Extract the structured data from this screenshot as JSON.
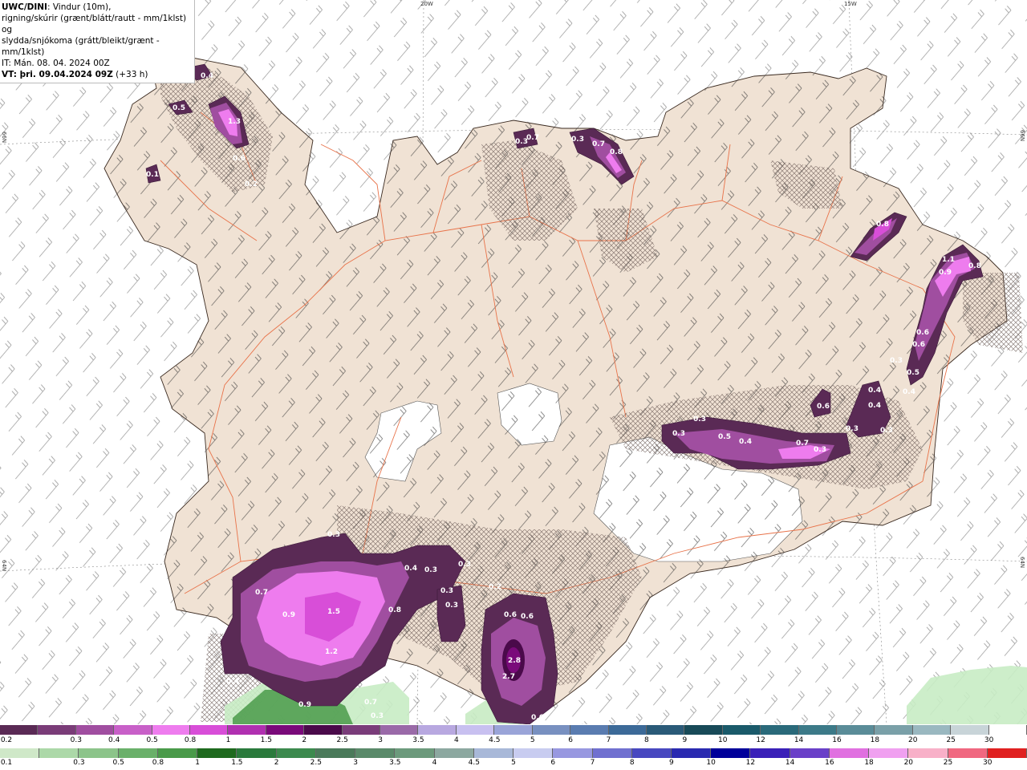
{
  "header": {
    "model": "UWC/DINI",
    "line1_rest": ": Vindur (10m),",
    "line2": "rigning/skúrir (grænt/blátt/rautt - mm/1klst) og",
    "line3": "slydda/snjókoma (grátt/bleikt/grænt - mm/1klst)",
    "line4": "IT: Mán. 08. 04. 2024 00Z",
    "line5_bold": "VT: þri. 09.04.2024 09Z",
    "line5_rest": " (+33 h)"
  },
  "graticule": {
    "lon_top": [
      "20W",
      "15W"
    ],
    "lat_left": [
      "66N",
      "64N"
    ],
    "lat_right": [
      "66N",
      "64N"
    ]
  },
  "values": [
    "0.4",
    "0.5",
    "1.3",
    "0.6",
    "0.1",
    "0.2",
    "0.3",
    "0.7",
    "0.3",
    "0.7",
    "0.8",
    "0.8",
    "1.1",
    "0.9",
    "0.8",
    "0.6",
    "0.6",
    "0.3",
    "0.5",
    "0.4",
    "0.6",
    "0.4",
    "0.4",
    "0.3",
    "0.3",
    "0.3",
    "0.5",
    "0.4",
    "0.7",
    "0.3",
    "0.3",
    "0.4",
    "0.3",
    "0.3",
    "0.2",
    "0.3",
    "0.3",
    "0.3",
    "0.7",
    "0.9",
    "1.5",
    "0.8",
    "1.2",
    "0.4",
    "0.9",
    "0.7",
    "0.3",
    "0.6",
    "0.6",
    "2.8",
    "2.7",
    "0.6"
  ],
  "legend_snow": {
    "labels": [
      "0.2",
      "0.3",
      "0.4",
      "0.5",
      "0.8",
      "1",
      "1.5",
      "2",
      "2.5",
      "3",
      "3.5",
      "4",
      "4.5",
      "5",
      "6",
      "7",
      "8",
      "9",
      "10",
      "12",
      "14",
      "16",
      "18",
      "20",
      "25",
      "30"
    ],
    "colors": [
      "#5a2a55",
      "#7a3c78",
      "#a04ea0",
      "#c860c8",
      "#ee7cee",
      "#d84ed8",
      "#b030b0",
      "#7a0a7a",
      "#4a0a4a",
      "#7a3c7a",
      "#9a6aa8",
      "#b8a8e0",
      "#c8c0f0",
      "#9aa4d8",
      "#7890c0",
      "#5a7cb0",
      "#3c6a98",
      "#2a5a78",
      "#184a58",
      "#1a5a6a",
      "#2a6a7a",
      "#3c7a88",
      "#5a8c98",
      "#7aa0a8",
      "#9ab8c0",
      "#c8d4d8",
      "#ffffff"
    ]
  },
  "legend_rain": {
    "labels": [
      "0.1",
      "0.3",
      "0.5",
      "0.8",
      "1",
      "1.5",
      "2",
      "2.5",
      "3",
      "3.5",
      "4",
      "4.5",
      "5",
      "6",
      "7",
      "8",
      "9",
      "10",
      "12",
      "14",
      "16",
      "18",
      "20",
      "25",
      "30"
    ],
    "colors": [
      "#cfe8c8",
      "#acd8a8",
      "#8cc48a",
      "#6ab06a",
      "#4a9a4a",
      "#1e6a1e",
      "#2a7a3c",
      "#3c8a4e",
      "#4a7a5a",
      "#5a8a6a",
      "#6c9a7c",
      "#8ca8a0",
      "#a8b8d8",
      "#c8ccf0",
      "#9898e0",
      "#7070d0",
      "#4848c0",
      "#2a2ab0",
      "#00009a",
      "#3a20b8",
      "#6a40c8",
      "#e070e0",
      "#f0a0f0",
      "#f8b0c8",
      "#f06880",
      "#e02020"
    ]
  }
}
